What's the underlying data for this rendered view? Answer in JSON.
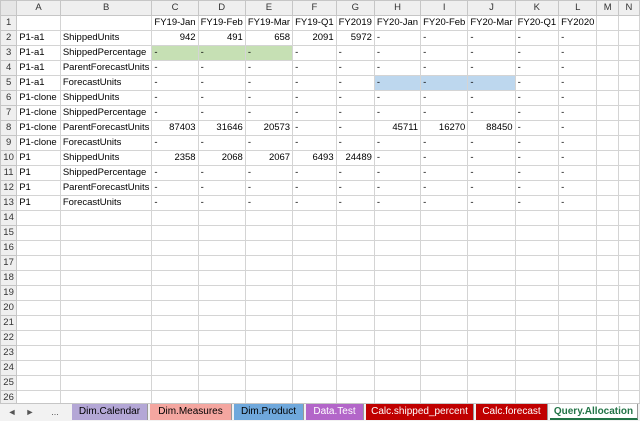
{
  "columns": [
    "A",
    "B",
    "C",
    "D",
    "E",
    "F",
    "G",
    "H",
    "I",
    "J",
    "K",
    "L",
    "M",
    "N"
  ],
  "header_row": [
    "",
    "",
    "FY19-Jan",
    "FY19-Feb",
    "FY19-Mar",
    "FY19-Q1",
    "FY2019",
    "FY20-Jan",
    "FY20-Feb",
    "FY20-Mar",
    "FY20-Q1",
    "FY2020",
    "",
    ""
  ],
  "rows": [
    [
      "P1-a1",
      "ShippedUnits",
      "942",
      "491",
      "658",
      "2091",
      "5972",
      "-",
      "-",
      "-",
      "-",
      "-",
      "",
      ""
    ],
    [
      "P1-a1",
      "ShippedPercentage",
      "-",
      "-",
      "-",
      "-",
      "-",
      "-",
      "-",
      "-",
      "-",
      "-",
      "",
      ""
    ],
    [
      "P1-a1",
      "ParentForecastUnits",
      "-",
      "-",
      "-",
      "-",
      "-",
      "-",
      "-",
      "-",
      "-",
      "-",
      "",
      ""
    ],
    [
      "P1-a1",
      "ForecastUnits",
      "-",
      "-",
      "-",
      "-",
      "-",
      "-",
      "-",
      "-",
      "-",
      "-",
      "",
      ""
    ],
    [
      "P1-clone",
      "ShippedUnits",
      "-",
      "-",
      "-",
      "-",
      "-",
      "-",
      "-",
      "-",
      "-",
      "-",
      "",
      ""
    ],
    [
      "P1-clone",
      "ShippedPercentage",
      "-",
      "-",
      "-",
      "-",
      "-",
      "-",
      "-",
      "-",
      "-",
      "-",
      "",
      ""
    ],
    [
      "P1-clone",
      "ParentForecastUnits",
      "87403",
      "31646",
      "20573",
      "-",
      "-",
      "45711",
      "16270",
      "88450",
      "-",
      "-",
      "",
      ""
    ],
    [
      "P1-clone",
      "ForecastUnits",
      "-",
      "-",
      "-",
      "-",
      "-",
      "-",
      "-",
      "-",
      "-",
      "-",
      "",
      ""
    ],
    [
      "P1",
      "ShippedUnits",
      "2358",
      "2068",
      "2067",
      "6493",
      "24489",
      "-",
      "-",
      "-",
      "-",
      "-",
      "",
      ""
    ],
    [
      "P1",
      "ShippedPercentage",
      "-",
      "-",
      "-",
      "-",
      "-",
      "-",
      "-",
      "-",
      "-",
      "-",
      "",
      ""
    ],
    [
      "P1",
      "ParentForecastUnits",
      "-",
      "-",
      "-",
      "-",
      "-",
      "-",
      "-",
      "-",
      "-",
      "-",
      "",
      ""
    ],
    [
      "P1",
      "ForecastUnits",
      "-",
      "-",
      "-",
      "-",
      "-",
      "-",
      "-",
      "-",
      "-",
      "-",
      "",
      ""
    ]
  ],
  "total_rows": 26,
  "highlights": [
    {
      "row": 3,
      "cols": [
        "C",
        "D",
        "E"
      ],
      "color": "#c6e0b4"
    },
    {
      "row": 5,
      "cols": [
        "H",
        "I",
        "J"
      ],
      "color": "#bdd7ee"
    }
  ],
  "nav": {
    "prev": "◄",
    "next": "►",
    "more": "..."
  },
  "tabs": [
    {
      "label": "Dim.Calendar",
      "color": "#b4a7d6",
      "text_color": "#000000"
    },
    {
      "label": "Dim.Measures",
      "color": "#f4a6a0",
      "text_color": "#000000"
    },
    {
      "label": "Dim.Product",
      "color": "#6fa8dc",
      "text_color": "#000000"
    },
    {
      "label": "Data.Test",
      "color": "#b366c9",
      "text_color": "#ffffff"
    },
    {
      "label": "Calc.shipped_percent",
      "color": "#c00000",
      "text_color": "#ffffff"
    },
    {
      "label": "Calc.forecast",
      "color": "#c00000",
      "text_color": "#ffffff"
    },
    {
      "label": "Query.Allocation",
      "color": "#ffffff",
      "text_color": "#217346",
      "active": true
    }
  ]
}
